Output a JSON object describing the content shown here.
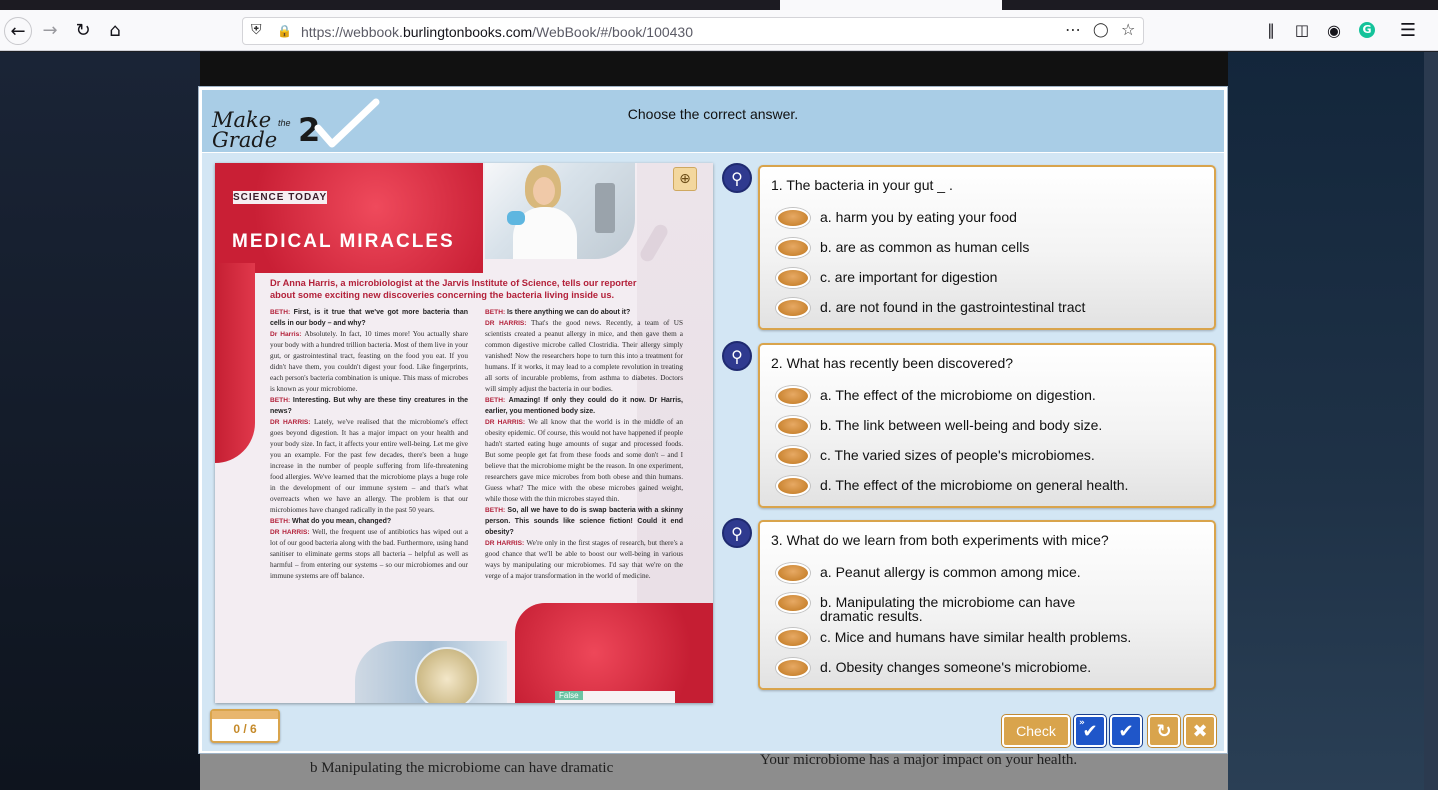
{
  "browser": {
    "url_prefix": "https://webbook.",
    "url_domain": "burlingtonbooks.com",
    "url_path": "/WebBook/#/book/100430"
  },
  "background_page": {
    "option_b": "b   Manipulating the microbiome can have dramatic",
    "right_text": "Your microbiome has a major impact on your health."
  },
  "modal": {
    "logo": {
      "make": "Make",
      "the": "the",
      "grade": "Grade",
      "two": "2"
    },
    "instruction": "Choose the correct answer.",
    "article": {
      "section": "SCIENCE TODAY",
      "title": "MEDICAL MIRACLES",
      "intro": "Dr Anna Harris, a microbiologist at the Jarvis Institute of Science, tells our reporter about some exciting new discoveries concerning the bacteria living inside us.",
      "col1": [
        {
          "who": "BETH:",
          "q": "First, is it true that we've got more bacteria than cells in our body – and why?"
        },
        {
          "who": "Dr Harris:",
          "t": "Absolutely. In fact, 10 times more! You actually share your body with a hundred trillion bacteria. Most of them live in your gut, or gastrointestinal tract, feasting on the food you eat. If you didn't have them, you couldn't digest your food. Like fingerprints, each person's bacteria combination is unique. This mass of microbes is known as your microbiome."
        },
        {
          "who": "BETH:",
          "q": "Interesting. But why are these tiny creatures in the news?"
        },
        {
          "who": "DR HARRIS:",
          "t": "Lately, we've realised that the microbiome's effect goes beyond digestion. It has a major impact on your health and your body size. In fact, it affects your entire well-being. Let me give you an example. For the past few decades, there's been a huge increase in the number of people suffering from life-threatening food allergies. We've learned that the microbiome plays a huge role in the development of our immune system – and that's what overreacts when we have an allergy. The problem is that our microbiomes have changed radically in the past 50 years."
        },
        {
          "who": "BETH:",
          "q": "What do you mean, changed?"
        },
        {
          "who": "DR HARRIS:",
          "t": "Well, the frequent use of antibiotics has wiped out a lot of our good bacteria along with the bad. Furthermore, using hand sanitiser to eliminate germs stops all bacteria – helpful as well as harmful – from entering our systems – so our microbiomes and our immune systems are off balance."
        }
      ],
      "col2": [
        {
          "who": "BETH:",
          "q": "Is there anything we can do about it?"
        },
        {
          "who": "DR HARRIS:",
          "t": "That's the good news. Recently, a team of US scientists created a peanut allergy in mice, and then gave them a common digestive microbe called Clostridia. Their allergy simply vanished! Now the researchers hope to turn this into a treatment for humans. If it works, it may lead to a complete revolution in treating all sorts of incurable problems, from asthma to diabetes. Doctors will simply adjust the bacteria in our bodies."
        },
        {
          "who": "BETH:",
          "q": "Amazing! If only they could do it now. Dr Harris, earlier, you mentioned body size."
        },
        {
          "who": "DR HARRIS:",
          "t": "We all know that the world is in the middle of an obesity epidemic. Of course, this would not have happened if people hadn't started eating huge amounts of sugar and processed foods. But some people get fat from these foods and some don't – and I believe that the microbiome might be the reason. In one experiment, researchers gave mice microbes from both obese and thin humans. Guess what? The mice with the obese microbes gained weight, while those with the thin microbes stayed thin."
        },
        {
          "who": "BETH:",
          "q": "So, all we have to do is swap bacteria with a skinny person. This sounds like science fiction! Could it end obesity?"
        },
        {
          "who": "DR HARRIS:",
          "t": "We're only in the first stages of research, but there's a good chance that we'll be able to boost our well-being in various ways by manipulating our microbiomes. I'd say that we're on the verge of a major transformation in the world of medicine."
        }
      ],
      "footer_tag": "False"
    },
    "questions": [
      {
        "text": "1. The bacteria in your gut _ .",
        "options": [
          "a. harm you by eating your food",
          "b. are as common as human cells",
          "c. are important for digestion",
          "d. are not found in the gastrointestinal tract"
        ]
      },
      {
        "text": "2. What has recently been discovered?",
        "options": [
          "a. The effect of the microbiome on digestion.",
          "b. The link between well-being and body size.",
          "c. The varied sizes of people's microbiomes.",
          "d. The effect of the microbiome on general health."
        ]
      },
      {
        "text": "3. What do we learn from both experiments with mice?",
        "options": [
          "a. Peanut allergy is common among mice.",
          "b. Manipulating the microbiome can have dramatic results.",
          "c. Mice and humans have similar health problems.",
          "d. Obesity changes someone's microbiome."
        ]
      }
    ],
    "score": "0 / 6",
    "check_label": "Check"
  },
  "colors": {
    "accent_gold": "#d9a44c",
    "header_blue": "#a9cde6",
    "body_blue": "#d3e6f4",
    "button_blue": "#1f56c9"
  },
  "icons": [
    "back-arrow-icon",
    "forward-arrow-icon",
    "reload-icon",
    "home-icon",
    "shield-icon",
    "lock-icon",
    "more-icon",
    "pocket-icon",
    "star-icon",
    "library-icon",
    "sidebar-icon",
    "account-icon",
    "grammarly-icon",
    "menu-icon",
    "zoom-in-icon",
    "magnify-icon",
    "check-all-icon",
    "check-icon",
    "refresh-icon",
    "close-icon"
  ]
}
